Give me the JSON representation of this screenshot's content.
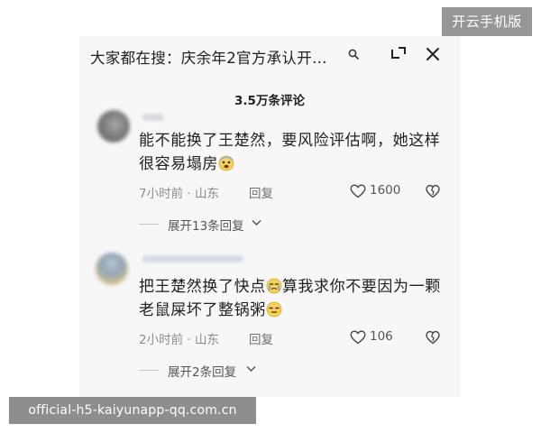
{
  "search_bar": {
    "text": "大家都在搜：庆余年2官方承认开…",
    "search_icon": "search-icon"
  },
  "toolbar": {
    "collapse_icon": "collapse-icon",
    "close_icon": "close-icon"
  },
  "comment_count": "3.5万条评论",
  "comments": [
    {
      "text_part1": "能不能换了王楚然，要风险评估啊，她这样很容易塌房",
      "emoji_after": "fearful-face",
      "time": "7小时前 · 山东",
      "reply_label": "回复",
      "likes": "1600",
      "expand_label": "展开13条回复"
    },
    {
      "text_part1": "把王楚然换了快点",
      "emoji_mid": "crying-face",
      "text_part2": "算我求你不要因为一颗老鼠屎坏了整锅粥",
      "emoji_after": "annoyed-face",
      "time": "2小时前 · 山东",
      "reply_label": "回复",
      "likes": "106",
      "expand_label": "展开2条回复"
    }
  ],
  "watermarks": {
    "top_right": "开云手机版",
    "bottom_left": "official-h5-kaiyunapp-qq.com.cn"
  },
  "colors": {
    "background": "#f7f7f8",
    "text": "#1e1e1e",
    "meta_text": "#8c8c8c",
    "watermark_bg": "#878787"
  }
}
